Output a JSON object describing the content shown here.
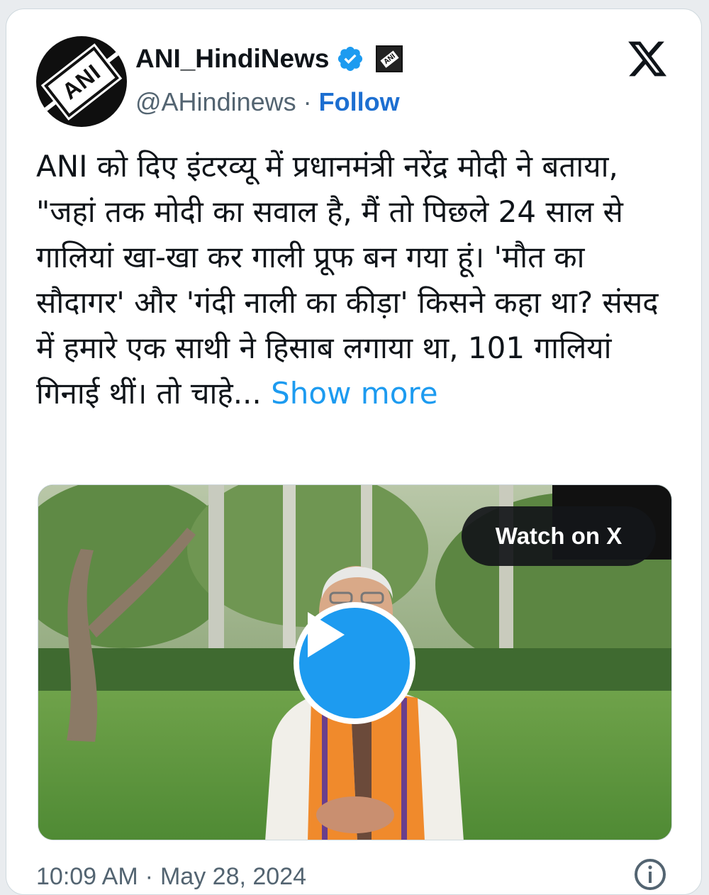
{
  "account": {
    "display_name": "ANI_HindiNews",
    "handle": "@AHindinews",
    "separator": "·",
    "follow_label": "Follow",
    "avatar_text": "ANI",
    "badge_text": "ANI"
  },
  "tweet": {
    "text": "ANI को दिए इंटरव्यू में प्रधानमंत्री नरेंद्र मोदी ने बताया, \"जहां तक मोदी का सवाल है, मैं तो पिछले 24 साल से गालियां खा-खा कर गाली प्रूफ बन गया हूं। 'मौत का सौदागर' और 'गंदी नाली का कीड़ा' किसने कहा था? संसद में हमारे एक साथी ने हिसाब लगाया था, 101 गालियां  गिनाई थीं। तो चाहे...",
    "show_more_label": "Show more"
  },
  "media": {
    "watch_label": "Watch on X"
  },
  "footer": {
    "time": "10:09 AM",
    "separator": "·",
    "date": "May 28, 2024"
  },
  "colors": {
    "accent": "#1d9bf0",
    "follow": "#1d6fd1",
    "verified": "#1d9bf0",
    "text": "#0f1419",
    "muted": "#536471"
  },
  "icons": {
    "verified": "verified-badge-icon",
    "x_logo": "x-logo-icon",
    "play": "play-icon",
    "info": "info-icon"
  }
}
